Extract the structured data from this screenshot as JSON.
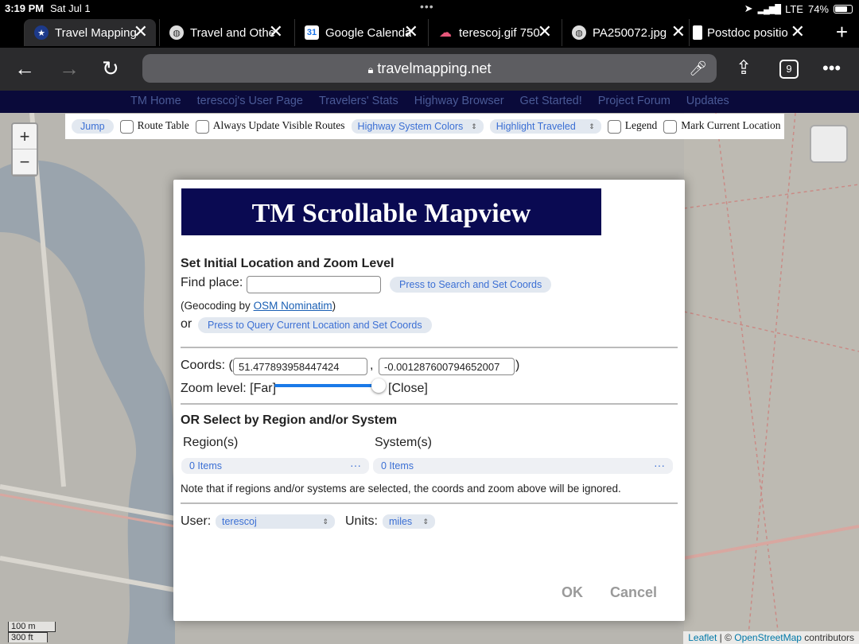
{
  "status": {
    "time": "3:19 PM",
    "date": "Sat Jul 1",
    "carrier": "LTE",
    "battery": "74%",
    "battery_level": 0.74
  },
  "tabs": [
    {
      "label": "Travel Mapping",
      "favicon": "tm-star-icon",
      "active": true
    },
    {
      "label": "Travel and Othe",
      "favicon": "globe-icon",
      "active": false
    },
    {
      "label": "Google Calenda",
      "favicon": "google-calendar-icon",
      "active": false
    },
    {
      "label": "terescoj.gif 750",
      "favicon": "cloud-icon",
      "active": false
    },
    {
      "label": "PA250072.jpg",
      "favicon": "globe-icon",
      "active": false
    },
    {
      "label": "Postdoc positio",
      "favicon": "page-icon",
      "active": false
    }
  ],
  "toolbar": {
    "url": "travelmapping.net",
    "tab_count": "9"
  },
  "sitenav": [
    "TM Home",
    "terescoj's User Page",
    "Travelers' Stats",
    "Highway Browser",
    "Get Started!",
    "Project Forum",
    "Updates"
  ],
  "controls": {
    "jump": "Jump",
    "route_table": "Route Table",
    "always_update": "Always Update Visible Routes",
    "color_select": "Highway System Colors",
    "highlight_select": "Highlight Traveled",
    "legend": "Legend",
    "mark_location": "Mark Current Location"
  },
  "map": {
    "scale_metric": "100 m",
    "scale_imperial": "300 ft",
    "attribution_leaflet": "Leaflet",
    "attribution_sep": " | © ",
    "attribution_osm": "OpenStreetMap",
    "attribution_tail": " contributors"
  },
  "dialog": {
    "title": "TM Scrollable Mapview",
    "section1": "Set Initial Location and Zoom Level",
    "find_place": "Find place:",
    "find_value": "",
    "search_btn": "Press to Search and Set Coords",
    "geocoding_prefix": "(Geocoding by ",
    "geocoding_link": "OSM Nominatim",
    "geocoding_suffix": ")",
    "or": "or",
    "query_btn": "Press to Query Current Location and Set Coords",
    "coords_label": "Coords: (",
    "lat": "51.477893958447424",
    "comma": ",",
    "lng": "-0.001287600794652007",
    "coords_close": ")",
    "zoom_label": "Zoom level: [Far]",
    "zoom_close": "[Close]",
    "zoom_fraction": 0.95,
    "section2": "OR Select by Region and/or System",
    "regions_label": "Region(s)",
    "systems_label": "System(s)",
    "regions_value": "0 Items",
    "systems_value": "0 Items",
    "note": "Note that if regions and/or systems are selected, the coords and zoom above will be ignored.",
    "user_label": "User:",
    "user_value": "terescoj",
    "units_label": "Units:",
    "units_value": "miles",
    "ok": "OK",
    "cancel": "Cancel"
  }
}
